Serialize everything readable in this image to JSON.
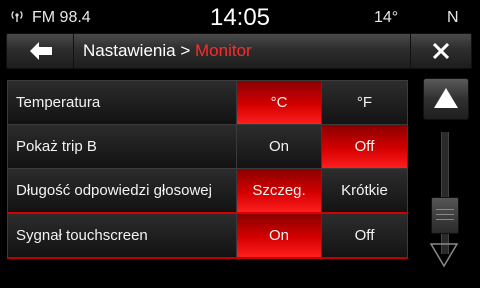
{
  "status_bar": {
    "radio_station": "FM 98.4",
    "time": "14:05",
    "outside_temp": "14°",
    "compass": "N"
  },
  "header": {
    "breadcrumb": "Nastawienia >",
    "current_page": "Monitor"
  },
  "settings": [
    {
      "label": "Temperatura",
      "options": [
        "°C",
        "°F"
      ],
      "selected_index": 0
    },
    {
      "label": "Pokaż trip B",
      "options": [
        "On",
        "Off"
      ],
      "selected_index": 1
    },
    {
      "label": "Długość odpowiedzi głosowej",
      "options": [
        "Szczeg.",
        "Krótkie"
      ],
      "selected_index": 0
    },
    {
      "label": "Sygnał touchscreen",
      "options": [
        "On",
        "Off"
      ],
      "selected_index": 0
    }
  ],
  "icons": {
    "radio": "radio-signal-icon",
    "back": "back-arrow-icon",
    "close": "close-icon",
    "scroll_up": "scroll-up-icon",
    "scroll_down": "scroll-down-icon"
  },
  "colors": {
    "accent_red": "#d40000",
    "title_highlight": "#ff2a2a"
  },
  "scroll": {
    "position_fraction": 0.55
  }
}
